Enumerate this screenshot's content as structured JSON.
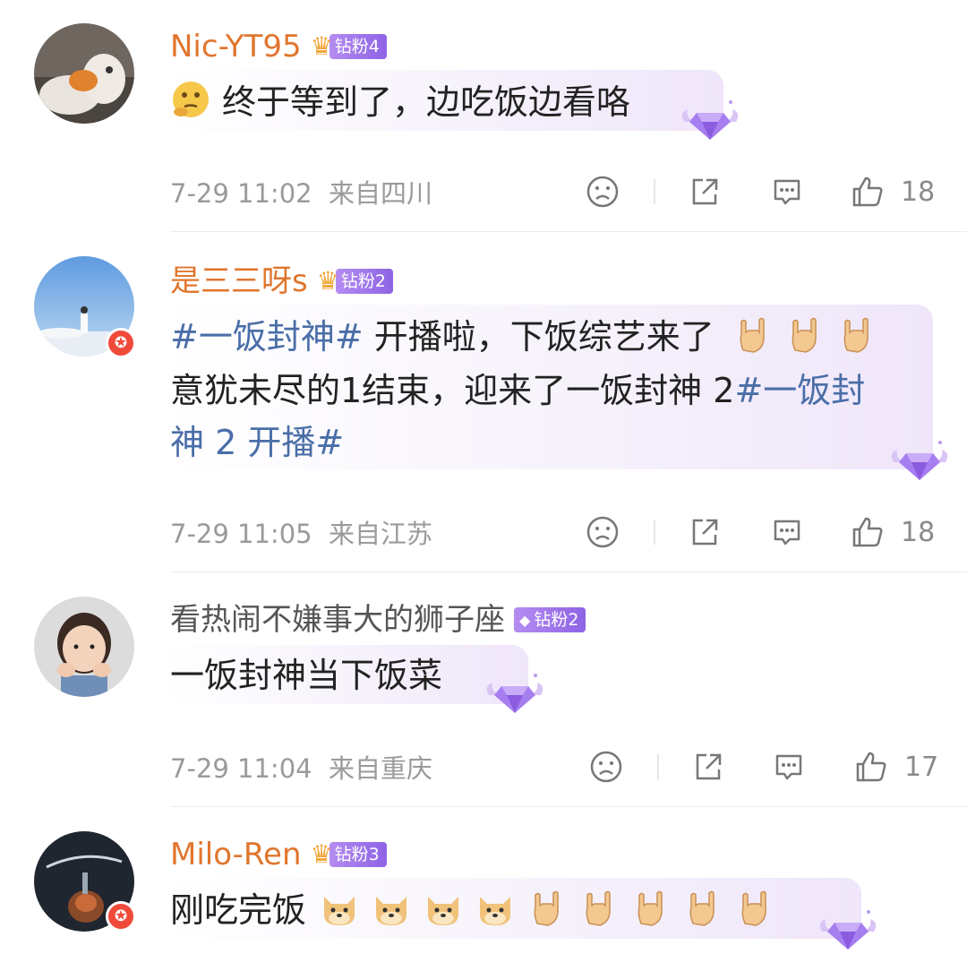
{
  "comments": [
    {
      "username": "Nic-YT95",
      "fan_badge": "钻粉4",
      "lines": [
        "终于等到了，边吃饭边看咯"
      ],
      "timestamp": "7-29 11:02",
      "location": "来自四川",
      "like_count": "18"
    },
    {
      "username": "是三三呀s",
      "fan_badge": "钻粉2",
      "line1_tag": "#一饭封神#",
      "line1_text": " 开播啦，下饭综艺来了",
      "line2_text": "意犹未尽的1结束，迎来了一饭封神 2",
      "line2_tag": "#一饭封",
      "line3_tag": "神 2 开播#",
      "timestamp": "7-29 11:05",
      "location": "来自江苏",
      "like_count": "18"
    },
    {
      "username": "看热闹不嫌事大的狮子座",
      "fan_badge": "钻粉2",
      "lines": [
        "一饭封神当下饭菜"
      ],
      "timestamp": "7-29 11:04",
      "location": "来自重庆",
      "like_count": "17"
    },
    {
      "username": "Milo-Ren",
      "fan_badge": "钻粉3",
      "lines": [
        "刚吃完饭"
      ]
    }
  ],
  "icons": {
    "dislike": "frown-face-icon",
    "share": "share-icon",
    "comment": "comment-icon",
    "like": "thumbs-up-icon"
  },
  "colors": {
    "username": "#e0762e",
    "topic_tag": "#4a6ea8",
    "fan_badge": "#9b72ea",
    "meta_text": "#9a9a9a"
  }
}
